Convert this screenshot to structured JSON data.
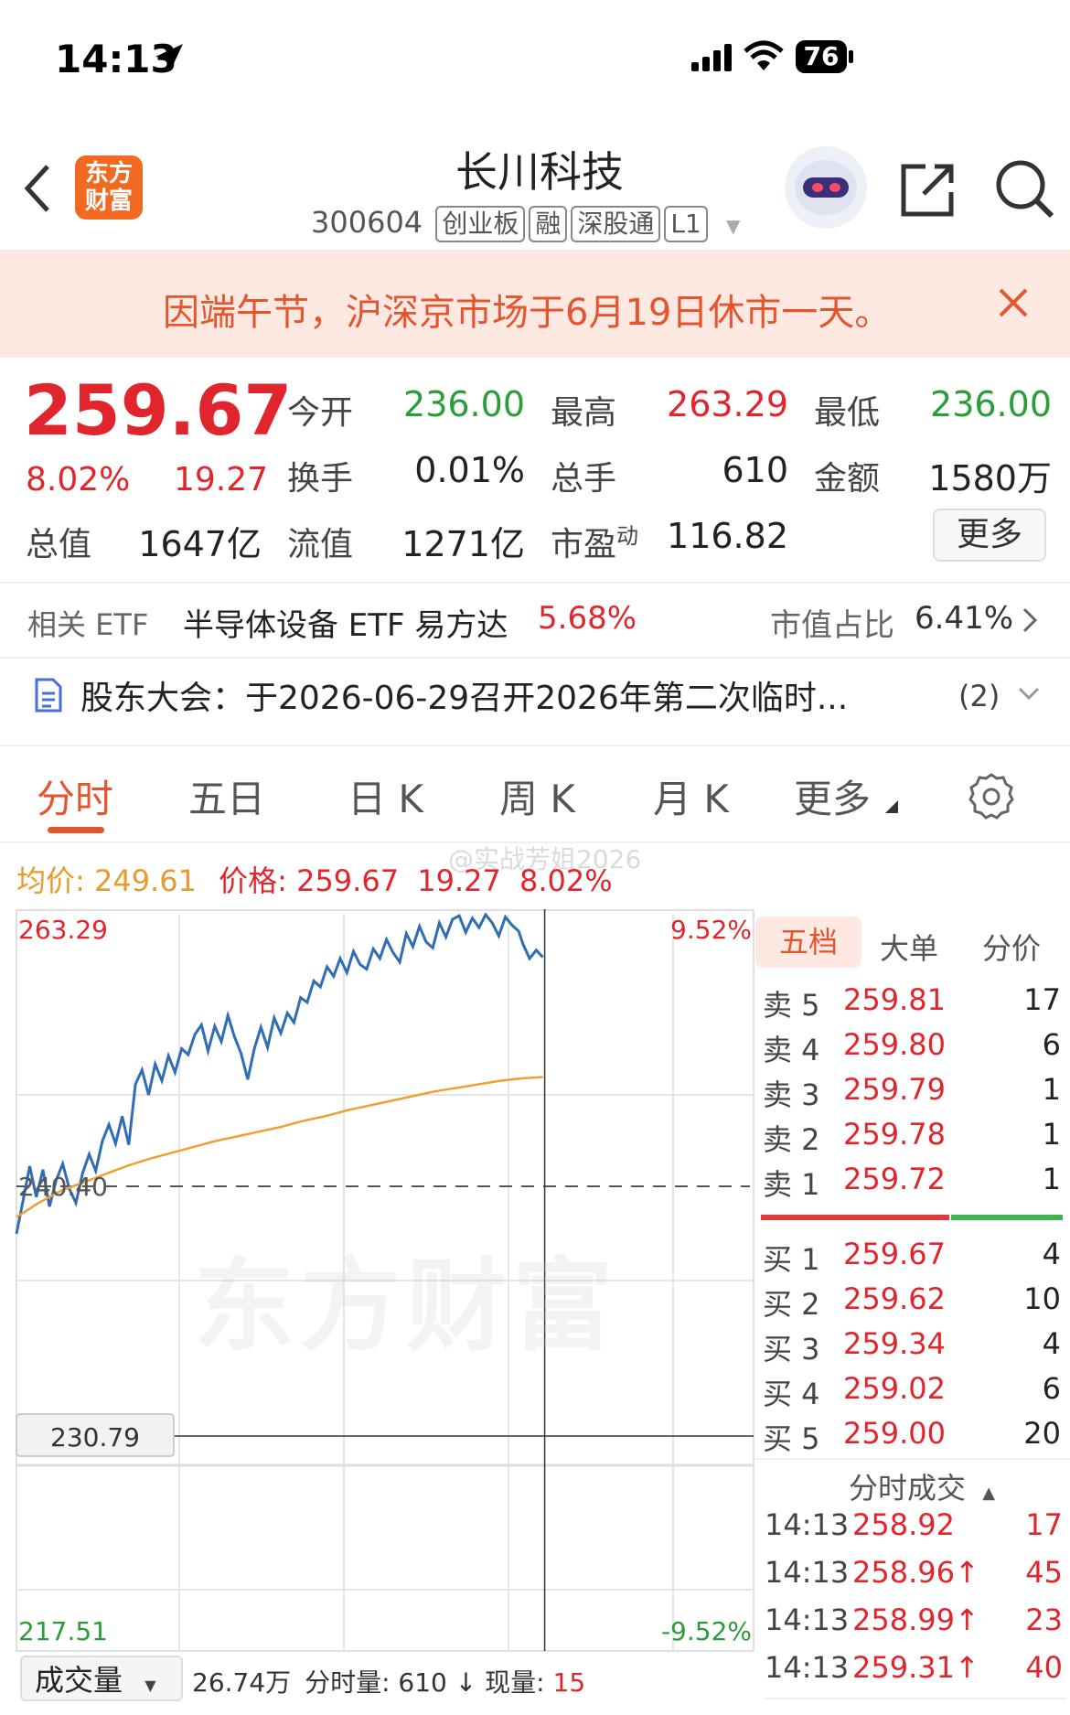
{
  "status_bar": {
    "time": "14:13",
    "battery": "76"
  },
  "header": {
    "logo_text_line1": "东方",
    "logo_text_line2": "财富",
    "title": "长川科技",
    "code": "300604",
    "tags": [
      "创业板",
      "融",
      "深股通",
      "L1"
    ]
  },
  "banner": {
    "text": "因端午节，沪深京市场于6月19日休市一天。"
  },
  "quote": {
    "price": "259.67",
    "change_pct": "8.02%",
    "change_amt": "19.27",
    "total_value_label": "总值",
    "total_value": "1647亿",
    "open_label": "今开",
    "open": "236.00",
    "high_label": "最高",
    "high": "263.29",
    "low_label": "最低",
    "low": "236.00",
    "turnover_label": "换手",
    "turnover": "0.01%",
    "volume_label": "总手",
    "volume": "610",
    "amount_label": "金额",
    "amount": "1580万",
    "float_value_label": "流值",
    "float_value": "1271亿",
    "pe_label": "市盈",
    "pe_sup": "动",
    "pe": "116.82",
    "more_button": "更多"
  },
  "etf": {
    "label": "相关 ETF",
    "name": "半导体设备 ETF 易方达",
    "pct": "5.68%",
    "share_label": "市值占比",
    "share": "6.41%"
  },
  "notice": {
    "text": "股东大会：于2026-06-29召开2026年第二次临时...",
    "count": "(2)"
  },
  "tabs": [
    "分时",
    "五日",
    "日 K",
    "周 K",
    "月 K",
    "更多"
  ],
  "chart_info": {
    "avg_label": "均价:",
    "avg": "249.61",
    "price_label": "价格:",
    "price": "259.67",
    "change": "19.27",
    "pct": "8.02%",
    "watermark": "@实战芳姐2026",
    "logo_watermark": "东方财富"
  },
  "chart_data": {
    "type": "line",
    "y_top_label": "263.29",
    "y_mid_label": "240.40",
    "y_bottom_label": "217.51",
    "pct_top_label": "9.52%",
    "pct_bottom_label": "-9.52%",
    "crosshair_price": "230.79",
    "ylim": [
      217.51,
      263.29
    ],
    "prev_close": 240.4,
    "x_range": [
      0,
      240
    ],
    "series": [
      {
        "name": "价格",
        "color": "#2f6db5",
        "x": [
          0,
          3,
          6,
          9,
          12,
          15,
          18,
          21,
          24,
          27,
          30,
          33,
          36,
          39,
          42,
          45,
          48,
          51,
          54,
          57,
          60,
          63,
          66,
          69,
          72,
          75,
          78,
          81,
          84,
          87,
          90,
          93,
          96,
          99,
          102,
          105,
          108,
          111,
          114,
          117,
          120,
          123,
          126,
          129,
          132,
          135,
          138,
          141,
          144,
          147,
          150,
          153,
          156,
          159,
          162,
          165,
          168,
          171,
          174,
          177,
          180,
          183,
          186,
          189,
          192,
          195,
          198,
          201,
          204,
          207,
          210,
          213,
          216,
          219,
          222,
          225,
          228,
          230,
          233,
          236,
          239
        ],
        "y": [
          236.4,
          239.2,
          242.1,
          239.5,
          241.8,
          238.7,
          240.9,
          242.3,
          240.2,
          239.0,
          241.5,
          243.1,
          241.7,
          244.2,
          245.6,
          244.0,
          246.3,
          243.9,
          249.0,
          250.2,
          248.1,
          250.7,
          249.3,
          251.4,
          250.0,
          252.0,
          251.5,
          253.2,
          254.0,
          251.8,
          253.9,
          252.6,
          254.8,
          253.0,
          251.6,
          249.4,
          252.0,
          253.8,
          252.1,
          254.6,
          253.3,
          255.0,
          254.2,
          256.3,
          255.9,
          257.7,
          257.2,
          258.9,
          258.1,
          259.6,
          258.4,
          260.2,
          259.1,
          258.7,
          260.4,
          259.6,
          261.2,
          260.1,
          259.3,
          261.7,
          260.6,
          262.3,
          261.0,
          260.5,
          262.6,
          261.4,
          262.9,
          263.2,
          261.8,
          263.0,
          262.2,
          263.29,
          262.6,
          261.5,
          263.1,
          262.4,
          261.9,
          260.8,
          259.6,
          260.3,
          259.7
        ]
      },
      {
        "name": "均价",
        "color": "#f0a030",
        "x": [
          0,
          10,
          20,
          30,
          40,
          50,
          60,
          70,
          80,
          90,
          100,
          110,
          120,
          130,
          140,
          150,
          160,
          170,
          180,
          190,
          200,
          210,
          220,
          230,
          239
        ],
        "y": [
          237.8,
          239.0,
          240.0,
          240.7,
          241.4,
          242.1,
          242.7,
          243.2,
          243.7,
          244.2,
          244.6,
          245.0,
          245.4,
          245.9,
          246.3,
          246.8,
          247.2,
          247.6,
          248.0,
          248.4,
          248.7,
          249.0,
          249.3,
          249.5,
          249.61
        ]
      }
    ]
  },
  "order_book": {
    "tabs": [
      "五档",
      "大单",
      "分价"
    ],
    "asks": [
      {
        "label": "卖 5",
        "price": "259.81",
        "vol": "17"
      },
      {
        "label": "卖 4",
        "price": "259.80",
        "vol": "6"
      },
      {
        "label": "卖 3",
        "price": "259.79",
        "vol": "1"
      },
      {
        "label": "卖 2",
        "price": "259.78",
        "vol": "1"
      },
      {
        "label": "卖 1",
        "price": "259.72",
        "vol": "1"
      }
    ],
    "bids": [
      {
        "label": "买 1",
        "price": "259.67",
        "vol": "4"
      },
      {
        "label": "买 2",
        "price": "259.62",
        "vol": "10"
      },
      {
        "label": "买 3",
        "price": "259.34",
        "vol": "4"
      },
      {
        "label": "买 4",
        "price": "259.02",
        "vol": "6"
      },
      {
        "label": "买 5",
        "price": "259.00",
        "vol": "20"
      }
    ],
    "trades_title": "分时成交",
    "trades": [
      {
        "time": "14:13",
        "price": "258.92",
        "arrow": "",
        "vol": "17"
      },
      {
        "time": "14:13",
        "price": "258.96",
        "arrow": "↑",
        "vol": "45"
      },
      {
        "time": "14:13",
        "price": "258.99",
        "arrow": "↑",
        "vol": "23"
      },
      {
        "time": "14:13",
        "price": "259.31",
        "arrow": "↑",
        "vol": "40"
      }
    ]
  },
  "volume_bar": {
    "selector": "成交量",
    "total": "26.74万",
    "minute_label": "分时量:",
    "minute": "610",
    "current_label": "现量:",
    "current": "15"
  }
}
